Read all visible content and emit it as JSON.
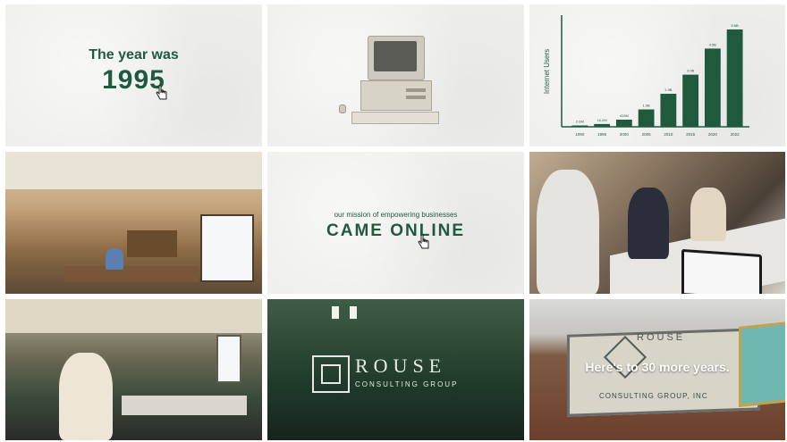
{
  "tile1": {
    "line1": "The year was",
    "line2": "1995"
  },
  "tile3": {
    "chart_data": {
      "type": "bar",
      "ylabel": "Internet Users",
      "categories": [
        "1990",
        "1995",
        "2000",
        "2005",
        "2010",
        "2015",
        "2020",
        "2022"
      ],
      "values": [
        0.03,
        0.16,
        0.41,
        1.0,
        1.9,
        3.0,
        4.5,
        5.6
      ],
      "value_labels": [
        "2.6M",
        "16.2M",
        "413M",
        "1.0B",
        "1.9B",
        "3.0B",
        "4.5B",
        "5.6B"
      ],
      "bar_color": "#1f5a3f"
    }
  },
  "tile5": {
    "small": "our mission of empowering businesses",
    "big": "CAME ONLINE"
  },
  "tile8": {
    "brand": "ROUSE",
    "sub": "CONSULTING GROUP"
  },
  "tile9": {
    "sign_brand": "ROUSE",
    "sign_sub": "CONSULTING GROUP, INC",
    "overlay": "Here's to 30 more years."
  },
  "colors": {
    "brand_green": "#1f5a3f",
    "paper": "#eeeeec"
  },
  "icons": {
    "pointer": "hand-cursor-icon"
  }
}
